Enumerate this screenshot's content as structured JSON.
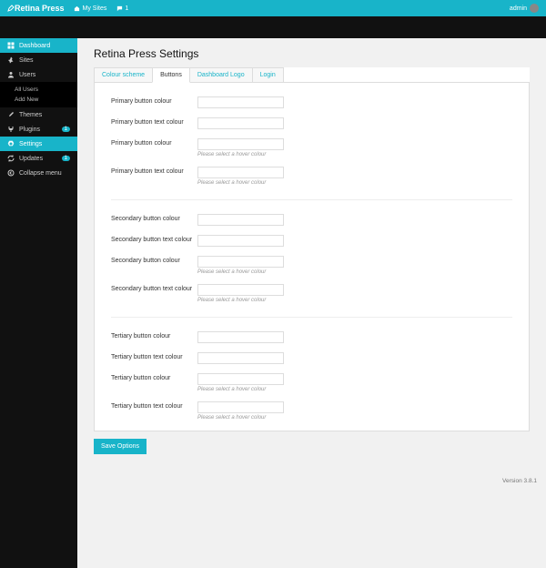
{
  "adminBar": {
    "brand": "Retina Press",
    "mySitesIcon": "house",
    "mySites": "My Sites",
    "commentsIcon": "comment",
    "commentsCount": "1",
    "user": "admin"
  },
  "sidebar": [
    {
      "icon": "dashboard",
      "label": "Dashboard",
      "active": true
    },
    {
      "icon": "pin",
      "label": "Sites"
    },
    {
      "icon": "user",
      "label": "Users",
      "sub": [
        "All Users",
        "Add New"
      ]
    },
    {
      "icon": "brush",
      "label": "Themes"
    },
    {
      "icon": "plug",
      "label": "Plugins",
      "badge": "1"
    },
    {
      "icon": "gear",
      "label": "Settings",
      "active": true
    },
    {
      "icon": "refresh",
      "label": "Updates",
      "badge": "1"
    },
    {
      "icon": "collapse",
      "label": "Collapse menu"
    }
  ],
  "page": {
    "title": "Retina Press Settings",
    "tabs": [
      "Colour scheme",
      "Buttons",
      "Dashboard Logo",
      "Login"
    ],
    "activeTab": 1,
    "groups": [
      [
        {
          "label": "Primary button colour",
          "hint": ""
        },
        {
          "label": "Primary button text colour",
          "hint": ""
        },
        {
          "label": "Primary button colour",
          "hint": "Please select a hover colour"
        },
        {
          "label": "Primary button text colour",
          "hint": "Please select a hover colour"
        }
      ],
      [
        {
          "label": "Secondary button colour",
          "hint": ""
        },
        {
          "label": "Secondary button text colour",
          "hint": ""
        },
        {
          "label": "Secondary button colour",
          "hint": "Please select a hover colour"
        },
        {
          "label": "Secondary button text colour",
          "hint": "Please select a hover colour"
        }
      ],
      [
        {
          "label": "Tertiary button colour",
          "hint": ""
        },
        {
          "label": "Tertiary button text colour",
          "hint": ""
        },
        {
          "label": "Tertiary button colour",
          "hint": "Please select a hover colour"
        },
        {
          "label": "Tertiary button text colour",
          "hint": "Please select a hover colour"
        }
      ]
    ],
    "saveLabel": "Save Options",
    "version": "Version 3.8.1"
  }
}
